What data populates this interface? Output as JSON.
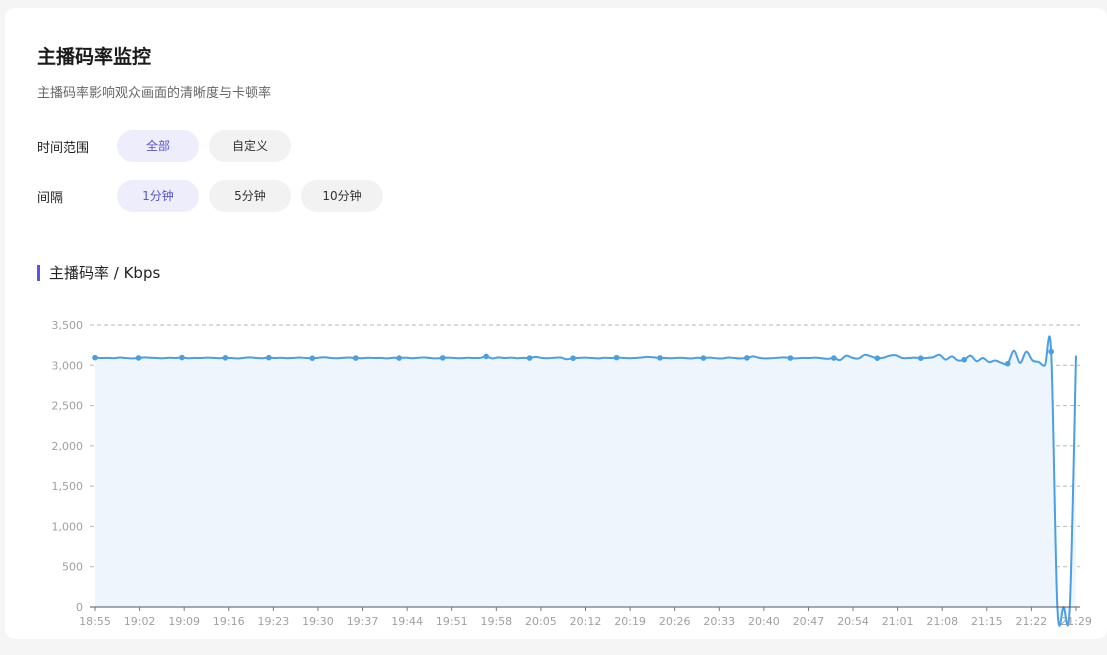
{
  "page": {
    "title": "主播码率监控",
    "subtitle": "主播码率影响观众画面的清晰度与卡顿率"
  },
  "filters": {
    "time_range": {
      "label": "时间范围",
      "options": [
        {
          "label": "全部",
          "active": true
        },
        {
          "label": "自定义",
          "active": false
        }
      ]
    },
    "interval": {
      "label": "间隔",
      "options": [
        {
          "label": "1分钟",
          "active": true
        },
        {
          "label": "5分钟",
          "active": false
        },
        {
          "label": "10分钟",
          "active": false
        }
      ]
    }
  },
  "section_title": "主播码率 / Kbps",
  "colors": {
    "accent": "#5b56d6",
    "line": "#4a9fe3",
    "area": "#eef5fd",
    "grid": "#b9b9b9"
  },
  "chart_data": {
    "type": "line",
    "title": "",
    "xlabel": "",
    "ylabel": "",
    "ylim": [
      0,
      3500
    ],
    "yticks": [
      "0",
      "500",
      "1,000",
      "1,500",
      "2,000",
      "2,500",
      "3,000",
      "3,500"
    ],
    "ytick_values": [
      0,
      500,
      1000,
      1500,
      2000,
      2500,
      3000,
      3500
    ],
    "xticks": [
      "18:55",
      "19:02",
      "19:09",
      "19:16",
      "19:23",
      "19:30",
      "19:37",
      "19:44",
      "19:51",
      "19:58",
      "20:05",
      "20:12",
      "20:19",
      "20:26",
      "20:33",
      "20:40",
      "20:47",
      "20:54",
      "21:01",
      "21:08",
      "21:15",
      "21:22",
      "21:29"
    ],
    "grid": true,
    "area_fill": true,
    "marker_every": 7,
    "series": [
      {
        "values": [
          3095,
          3090,
          3092,
          3088,
          3096,
          3090,
          3085,
          3091,
          3098,
          3093,
          3090,
          3088,
          3094,
          3090,
          3096,
          3087,
          3092,
          3090,
          3095,
          3092,
          3088,
          3093,
          3090,
          3085,
          3092,
          3098,
          3090,
          3088,
          3095,
          3090,
          3093,
          3087,
          3092,
          3096,
          3090,
          3088,
          3094,
          3100,
          3091,
          3087,
          3093,
          3096,
          3090,
          3088,
          3094,
          3090,
          3092,
          3085,
          3093,
          3090,
          3095,
          3088,
          3092,
          3098,
          3090,
          3086,
          3092,
          3095,
          3090,
          3088,
          3094,
          3090,
          3092,
          3110,
          3085,
          3098,
          3090,
          3095,
          3088,
          3092,
          3090,
          3105,
          3090,
          3088,
          3094,
          3096,
          3075,
          3088,
          3092,
          3095,
          3090,
          3086,
          3093,
          3090,
          3095,
          3092,
          3088,
          3090,
          3097,
          3105,
          3098,
          3092,
          3090,
          3088,
          3094,
          3090,
          3085,
          3093,
          3090,
          3095,
          3088,
          3084,
          3096,
          3090,
          3085,
          3092,
          3110,
          3092,
          3085,
          3088,
          3094,
          3098,
          3090,
          3086,
          3092,
          3090,
          3095,
          3088,
          3080,
          3090,
          3065,
          3120,
          3092,
          3085,
          3130,
          3110,
          3088,
          3095,
          3120,
          3125,
          3090,
          3090,
          3095,
          3088,
          3092,
          3100,
          3130,
          3070,
          3110,
          3060,
          3070,
          3120,
          3050,
          3090,
          3040,
          3060,
          3030,
          3020,
          3180,
          3030,
          3170,
          3060,
          3040,
          3000,
          3170,
          0,
          0,
          0,
          3120
        ]
      }
    ]
  }
}
